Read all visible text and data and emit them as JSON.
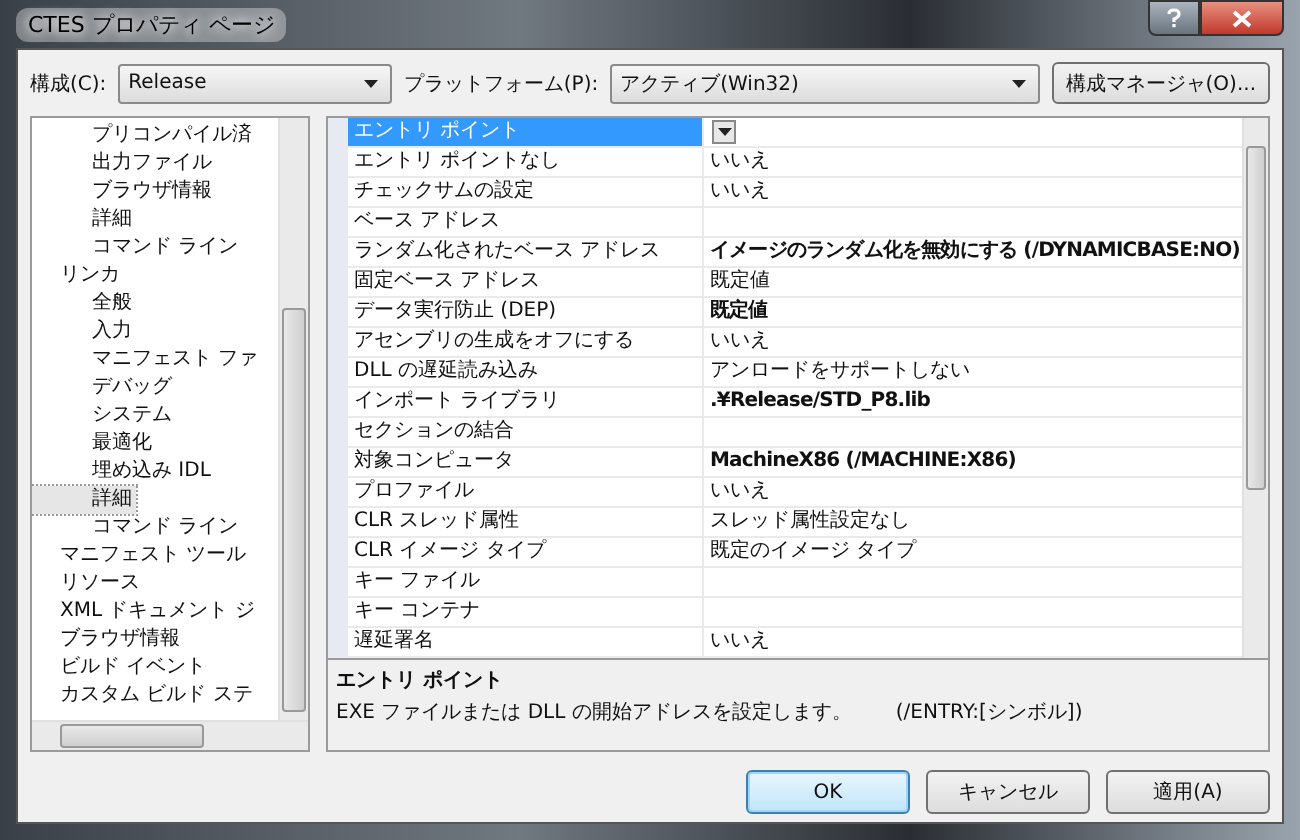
{
  "window": {
    "title": "CTES プロパティ ページ"
  },
  "toolbar": {
    "config_label": "構成(C):",
    "config_value": "Release",
    "platform_label": "プラットフォーム(P):",
    "platform_value": "アクティブ(Win32)",
    "manager_button": "構成マネージャ(O)..."
  },
  "tree": {
    "items": [
      {
        "children": [
          {
            "label": "プリコンパイル済",
            "selected": false
          },
          {
            "label": "出力ファイル",
            "selected": false
          },
          {
            "label": "ブラウザ情報",
            "selected": false
          },
          {
            "label": "詳細",
            "selected": false
          },
          {
            "label": "コマンド ライン",
            "selected": false
          }
        ]
      },
      {
        "label": "リンカ",
        "selected": false,
        "children": [
          {
            "label": "全般",
            "selected": false
          },
          {
            "label": "入力",
            "selected": false
          },
          {
            "label": "マニフェスト ファ",
            "selected": false
          },
          {
            "label": "デバッグ",
            "selected": false
          },
          {
            "label": "システム",
            "selected": false
          },
          {
            "label": "最適化",
            "selected": false
          },
          {
            "label": "埋め込み IDL",
            "selected": false
          },
          {
            "label": "詳細",
            "selected": true
          },
          {
            "label": "コマンド ライン",
            "selected": false
          }
        ]
      },
      {
        "label": "マニフェスト ツール",
        "selected": false
      },
      {
        "label": "リソース",
        "selected": false
      },
      {
        "label": "XML ドキュメント ジ",
        "selected": false
      },
      {
        "label": "ブラウザ情報",
        "selected": false
      },
      {
        "label": "ビルド イベント",
        "selected": false
      },
      {
        "label": "カスタム ビルド ステ",
        "selected": false
      }
    ]
  },
  "grid": {
    "rows": [
      {
        "name": "エントリ ポイント",
        "value": "",
        "selected": true
      },
      {
        "name": "エントリ ポイントなし",
        "value": "いいえ",
        "selected": false,
        "bold": false
      },
      {
        "name": "チェックサムの設定",
        "value": "いいえ",
        "selected": false,
        "bold": false
      },
      {
        "name": "ベース アドレス",
        "value": "",
        "selected": false
      },
      {
        "name": "ランダム化されたベース アドレス",
        "value": "イメージのランダム化を無効にする (/DYNAMICBASE:NO)",
        "selected": false,
        "bold": true
      },
      {
        "name": "固定ベース アドレス",
        "value": "既定値",
        "selected": false,
        "bold": false
      },
      {
        "name": "データ実行防止 (DEP)",
        "value": "既定値",
        "selected": false,
        "bold": true
      },
      {
        "name": "アセンブリの生成をオフにする",
        "value": "いいえ",
        "selected": false,
        "bold": false
      },
      {
        "name": "DLL の遅延読み込み",
        "value": "アンロードをサポートしない",
        "selected": false,
        "bold": false
      },
      {
        "name": "インポート ライブラリ",
        "value": ".¥Release/STD_P8.lib",
        "selected": false,
        "bold": true
      },
      {
        "name": "セクションの結合",
        "value": "",
        "selected": false
      },
      {
        "name": "対象コンピュータ",
        "value": "MachineX86 (/MACHINE:X86)",
        "selected": false,
        "bold": true
      },
      {
        "name": "プロファイル",
        "value": "いいえ",
        "selected": false,
        "bold": false
      },
      {
        "name": "CLR スレッド属性",
        "value": "スレッド属性設定なし",
        "selected": false,
        "bold": false
      },
      {
        "name": "CLR イメージ タイプ",
        "value": "既定のイメージ タイプ",
        "selected": false,
        "bold": false
      },
      {
        "name": "キー ファイル",
        "value": "",
        "selected": false
      },
      {
        "name": "キー コンテナ",
        "value": "",
        "selected": false
      },
      {
        "name": "遅延署名",
        "value": "いいえ",
        "selected": false,
        "bold": false
      }
    ]
  },
  "description": {
    "title": "エントリ ポイント",
    "text": "EXE ファイルまたは DLL の開始アドレスを設定します。",
    "switch": "(/ENTRY:[シンボル])"
  },
  "buttons": [
    {
      "label": "OK",
      "default": true
    },
    {
      "label": "キャンセル",
      "default": false
    },
    {
      "label": "適用(A)",
      "default": false
    }
  ]
}
